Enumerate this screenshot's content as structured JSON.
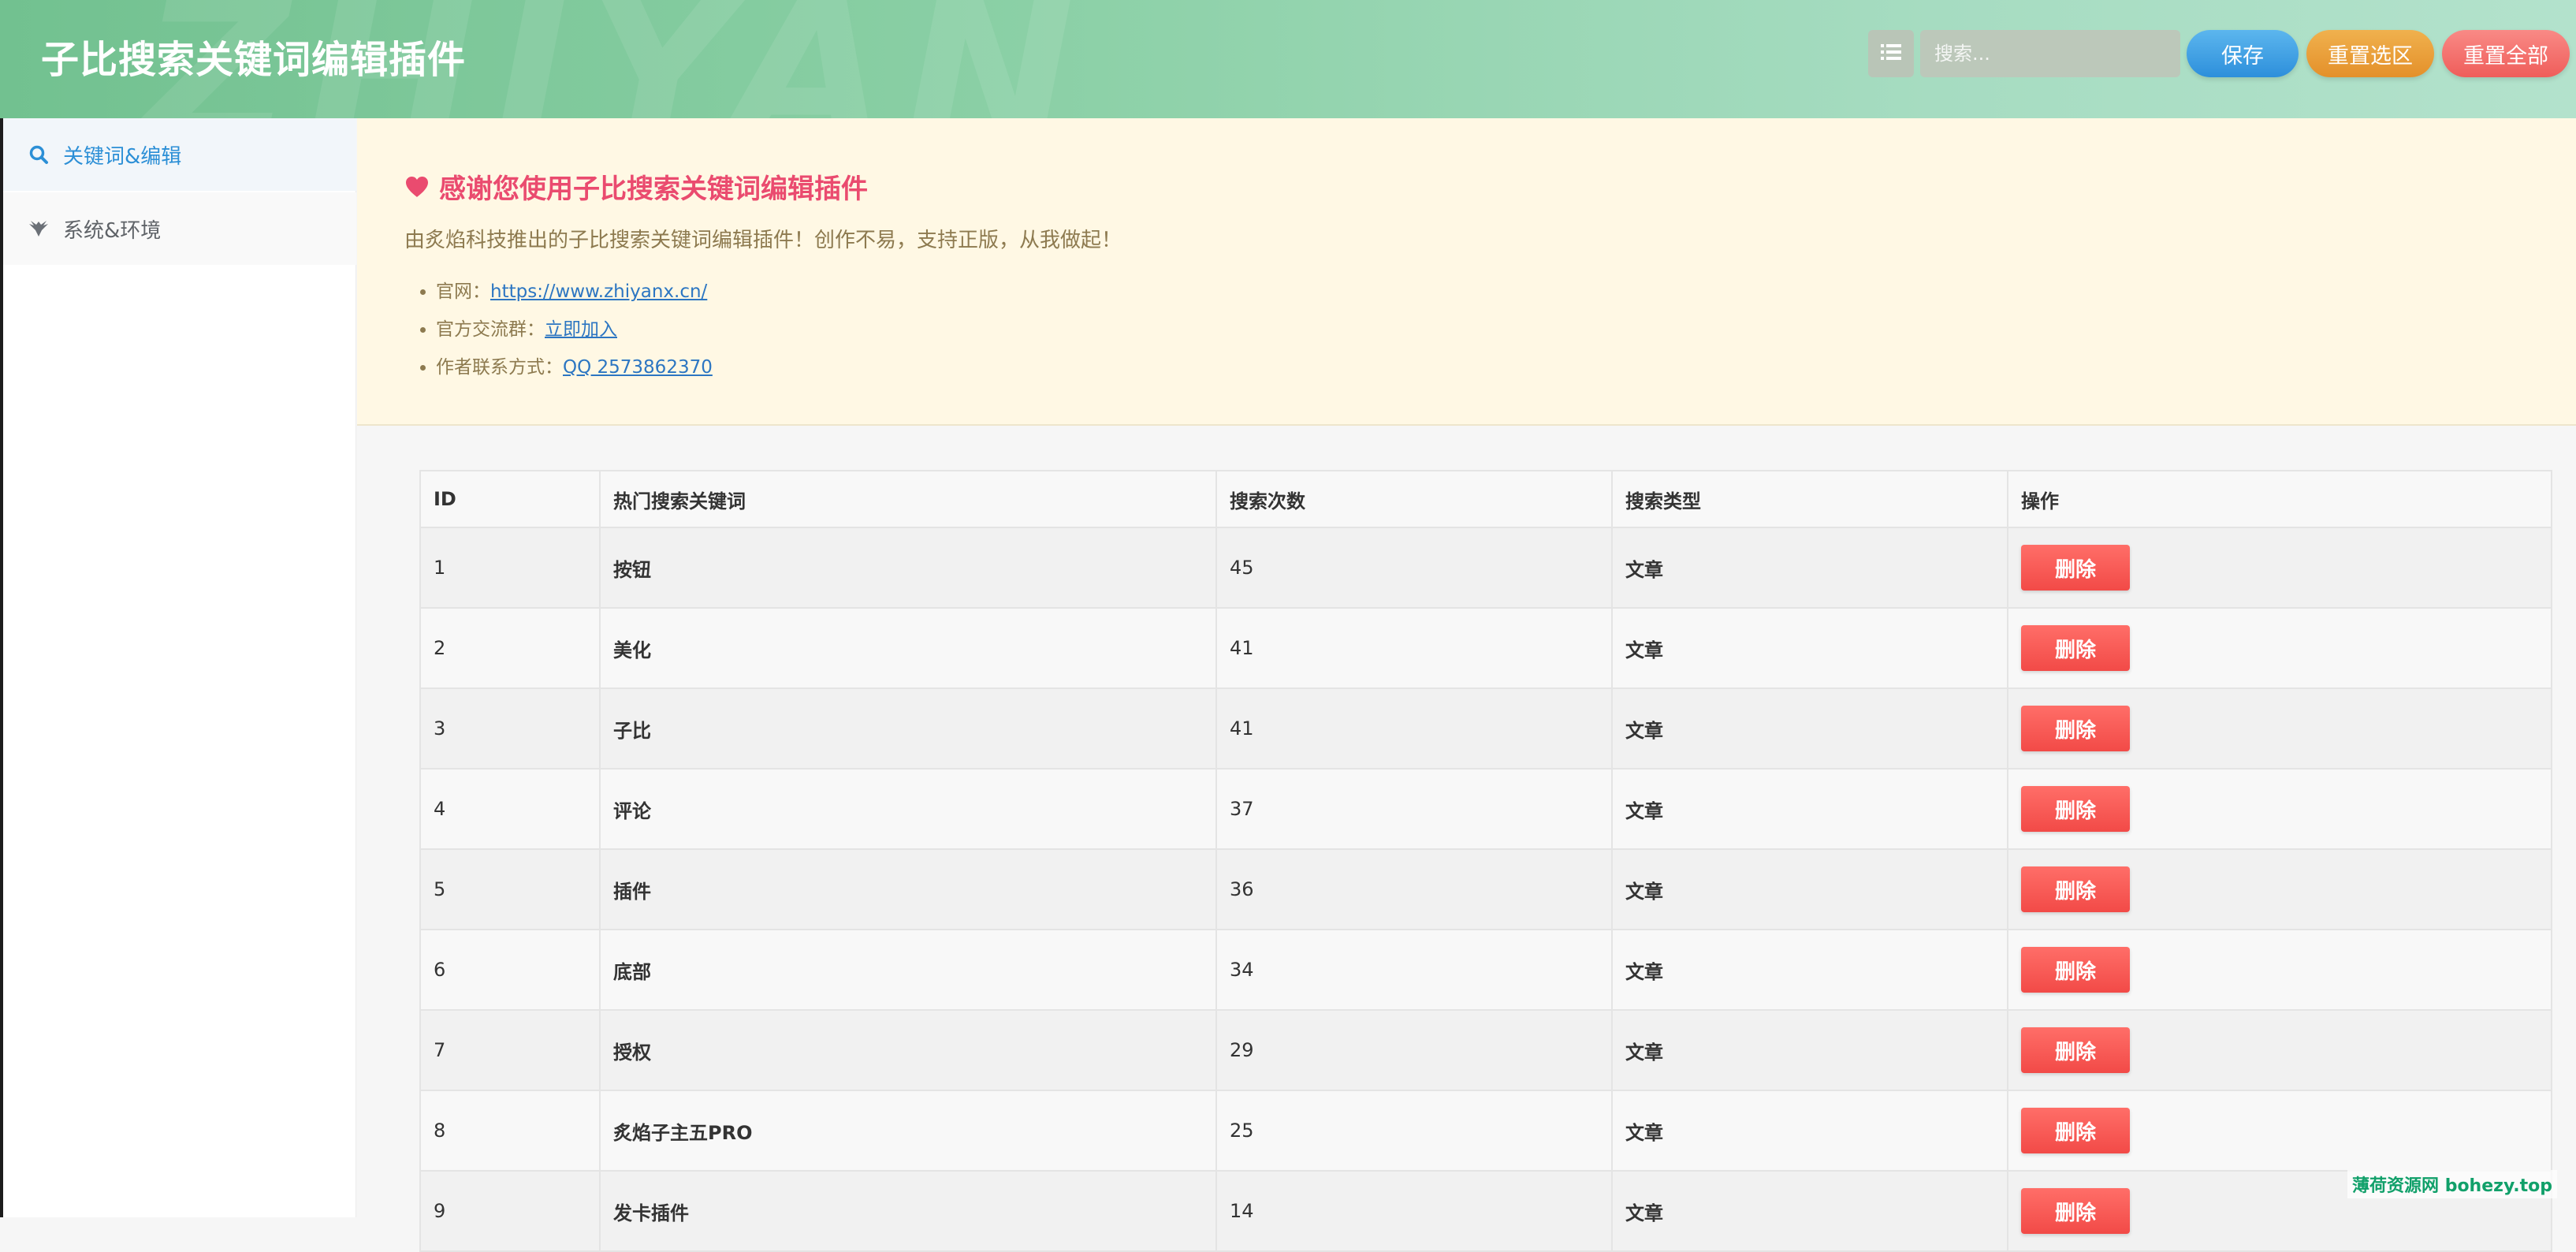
{
  "header": {
    "title": "子比搜索关键词编辑插件",
    "watermark": "ZHIYAN",
    "toggle_icon": "list-icon",
    "search_placeholder": "搜索...",
    "save_label": "保存",
    "reset_selection_label": "重置选区",
    "reset_all_label": "重置全部",
    "colors": {
      "save": "#2d8fdb",
      "reset_selection": "#e4902a",
      "reset_all": "#ef5d5a"
    }
  },
  "sidebar": {
    "items": [
      {
        "label": "关键词&编辑",
        "icon": "search-icon",
        "active": true
      },
      {
        "label": "系统&环境",
        "icon": "eagle-icon",
        "active": false
      }
    ]
  },
  "notice": {
    "heading": "感谢您使用子比搜索关键词编辑插件",
    "heading_icon": "heart-icon",
    "description": "由炙焰科技推出的子比搜索关键词编辑插件！创作不易，支持正版，从我做起！",
    "links": [
      {
        "label": "官网：",
        "link_text": "https://www.zhiyanx.cn/"
      },
      {
        "label": "官方交流群：",
        "link_text": "立即加入"
      },
      {
        "label": "作者联系方式：",
        "link_text": "QQ 2573862370"
      }
    ]
  },
  "table": {
    "headers": [
      "ID",
      "热门搜索关键词",
      "搜索次数",
      "搜索类型",
      "操作"
    ],
    "delete_label": "删除",
    "rows": [
      {
        "id": "1",
        "keyword": "按钮",
        "count": "45",
        "type": "文章"
      },
      {
        "id": "2",
        "keyword": "美化",
        "count": "41",
        "type": "文章"
      },
      {
        "id": "3",
        "keyword": "子比",
        "count": "41",
        "type": "文章"
      },
      {
        "id": "4",
        "keyword": "评论",
        "count": "37",
        "type": "文章"
      },
      {
        "id": "5",
        "keyword": "插件",
        "count": "36",
        "type": "文章"
      },
      {
        "id": "6",
        "keyword": "底部",
        "count": "34",
        "type": "文章"
      },
      {
        "id": "7",
        "keyword": "授权",
        "count": "29",
        "type": "文章"
      },
      {
        "id": "8",
        "keyword": "炙焰子主五PRO",
        "count": "25",
        "type": "文章"
      },
      {
        "id": "9",
        "keyword": "发卡插件",
        "count": "14",
        "type": "文章"
      }
    ]
  },
  "corner_watermark": "薄荷资源网 bohezy.top"
}
